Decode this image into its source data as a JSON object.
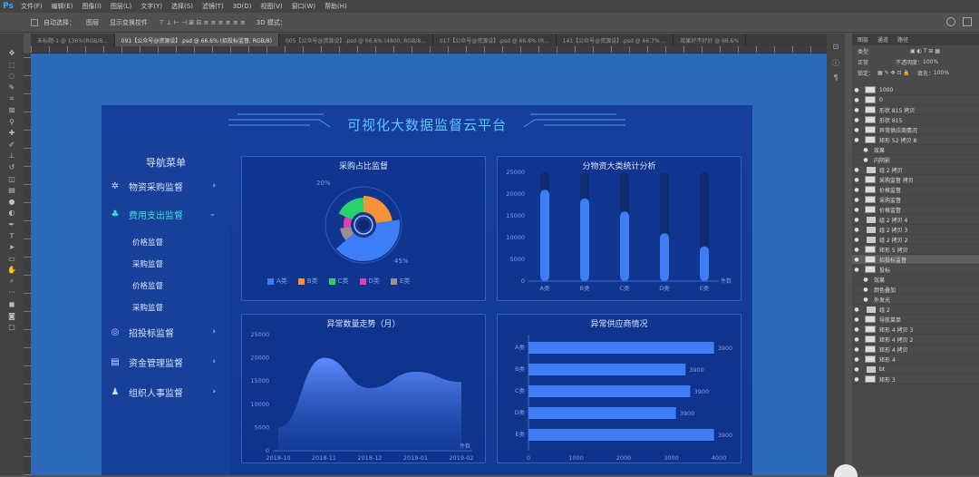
{
  "app": {
    "logo": "Ps"
  },
  "menubar": [
    "文件(F)",
    "编辑(E)",
    "图像(I)",
    "图层(L)",
    "文字(Y)",
    "选择(S)",
    "滤镜(T)",
    "3D(D)",
    "视图(V)",
    "窗口(W)",
    "帮助(H)"
  ],
  "options": {
    "auto_select": "自动选择：",
    "group": "图层",
    "show_transform": "显示变换控件",
    "mode3d": "3D 模式："
  },
  "tabs": [
    "未标题-1 @ 136%(RGB/8...",
    "091【公众号@资源设】.psd @ 66.6% (招投标监督, RGB/8)",
    "005【公众号@资源设】.psd @ 66.6% (4800, RGB/8...",
    "017【公众号@资源设】.psd @ 66.6% (R...",
    "141【公众号@资源设】.psd @ 66.7% ...",
    "效果好不好好 @ 66.6%"
  ],
  "dashboard": {
    "title": "可视化大数据监督云平台",
    "nav_title": "导航菜单",
    "nav": [
      {
        "label": "物资采购监督",
        "icon": "procurement-icon"
      },
      {
        "label": "费用支出监督",
        "icon": "expense-icon"
      },
      {
        "label": "招投标监督",
        "icon": "bidding-icon"
      },
      {
        "label": "资金管理监督",
        "icon": "fund-icon"
      },
      {
        "label": "组织人事监督",
        "icon": "personnel-icon"
      }
    ],
    "subnav": [
      "价格监督",
      "采购监督",
      "价格监督",
      "采购监督"
    ],
    "panels": {
      "pie": "采购占比监督",
      "bar": "分物资大类统计分析",
      "area": "异常数量走势（月）",
      "hbar": "异常供应商情况"
    }
  },
  "chart_data": [
    {
      "type": "pie",
      "title": "采购占比监督",
      "categories": [
        "A类",
        "B类",
        "C类",
        "D类",
        "E类"
      ],
      "values": [
        45,
        25,
        20,
        10,
        10
      ],
      "colors": [
        "#3d7df7",
        "#f7923a",
        "#27d36b",
        "#e43ea8",
        "#9d8f8a"
      ],
      "labels": [
        "20%",
        "45%"
      ]
    },
    {
      "type": "bar",
      "title": "分物资大类统计分析",
      "categories": [
        "A类",
        "B类",
        "C类",
        "D类",
        "E类"
      ],
      "values": [
        21000,
        19000,
        16000,
        11000,
        8000
      ],
      "ylim": [
        0,
        25000
      ],
      "yticks": [
        "25000",
        "20000",
        "15000",
        "10000",
        "5000",
        "0"
      ],
      "unit": "件数"
    },
    {
      "type": "area",
      "title": "异常数量走势（月）",
      "x": [
        "2018-10",
        "2018-11",
        "2018-12",
        "2019-01",
        "2019-02"
      ],
      "y": [
        5000,
        20000,
        13500,
        17000,
        14800
      ],
      "ylim": [
        0,
        25000
      ],
      "yticks": [
        "25000",
        "20000",
        "15000",
        "10000",
        "5000",
        "0"
      ],
      "unit": "件数"
    },
    {
      "type": "bar",
      "orientation": "horizontal",
      "title": "异常供应商情况",
      "categories": [
        "A类",
        "B类",
        "C类",
        "D类",
        "E类"
      ],
      "values": [
        3900,
        3300,
        3400,
        3100,
        3900
      ],
      "labels": [
        "3900",
        "3900",
        "3900",
        "3900",
        "3900"
      ],
      "xlim": [
        0,
        4000
      ],
      "xticks": [
        "0",
        "1000",
        "2000",
        "3000",
        "4000"
      ]
    }
  ],
  "layers": {
    "tabs": [
      "图层",
      "通道",
      "路径"
    ],
    "kind": "类型",
    "blend": "正常",
    "opacity_label": "不透明度：",
    "opacity": "100%",
    "lock_label": "锁定：",
    "fill_label": "填充：",
    "fill": "100%",
    "rows": [
      "1000",
      "0",
      "形状 815 拷贝",
      "形状 815",
      "异常供应商情况",
      "矩形 52 拷贝 8",
      "效果",
      "内阴影",
      "组 2 拷贝",
      "采购监督 拷贝",
      "价格监督",
      "采购监督",
      "价格监督",
      "组 2 拷贝 4",
      "组 2 拷贝 3",
      "组 2 拷贝 2",
      "矩形 5 拷贝",
      "招投标监督",
      "投标",
      "效果",
      "颜色叠加",
      "外发光",
      "组 2",
      "导航菜单",
      "矩形 4 拷贝 3",
      "矩形 4 拷贝 2",
      "矩形 4 拷贝",
      "矩形 4",
      "bt",
      "矩形 3"
    ]
  }
}
